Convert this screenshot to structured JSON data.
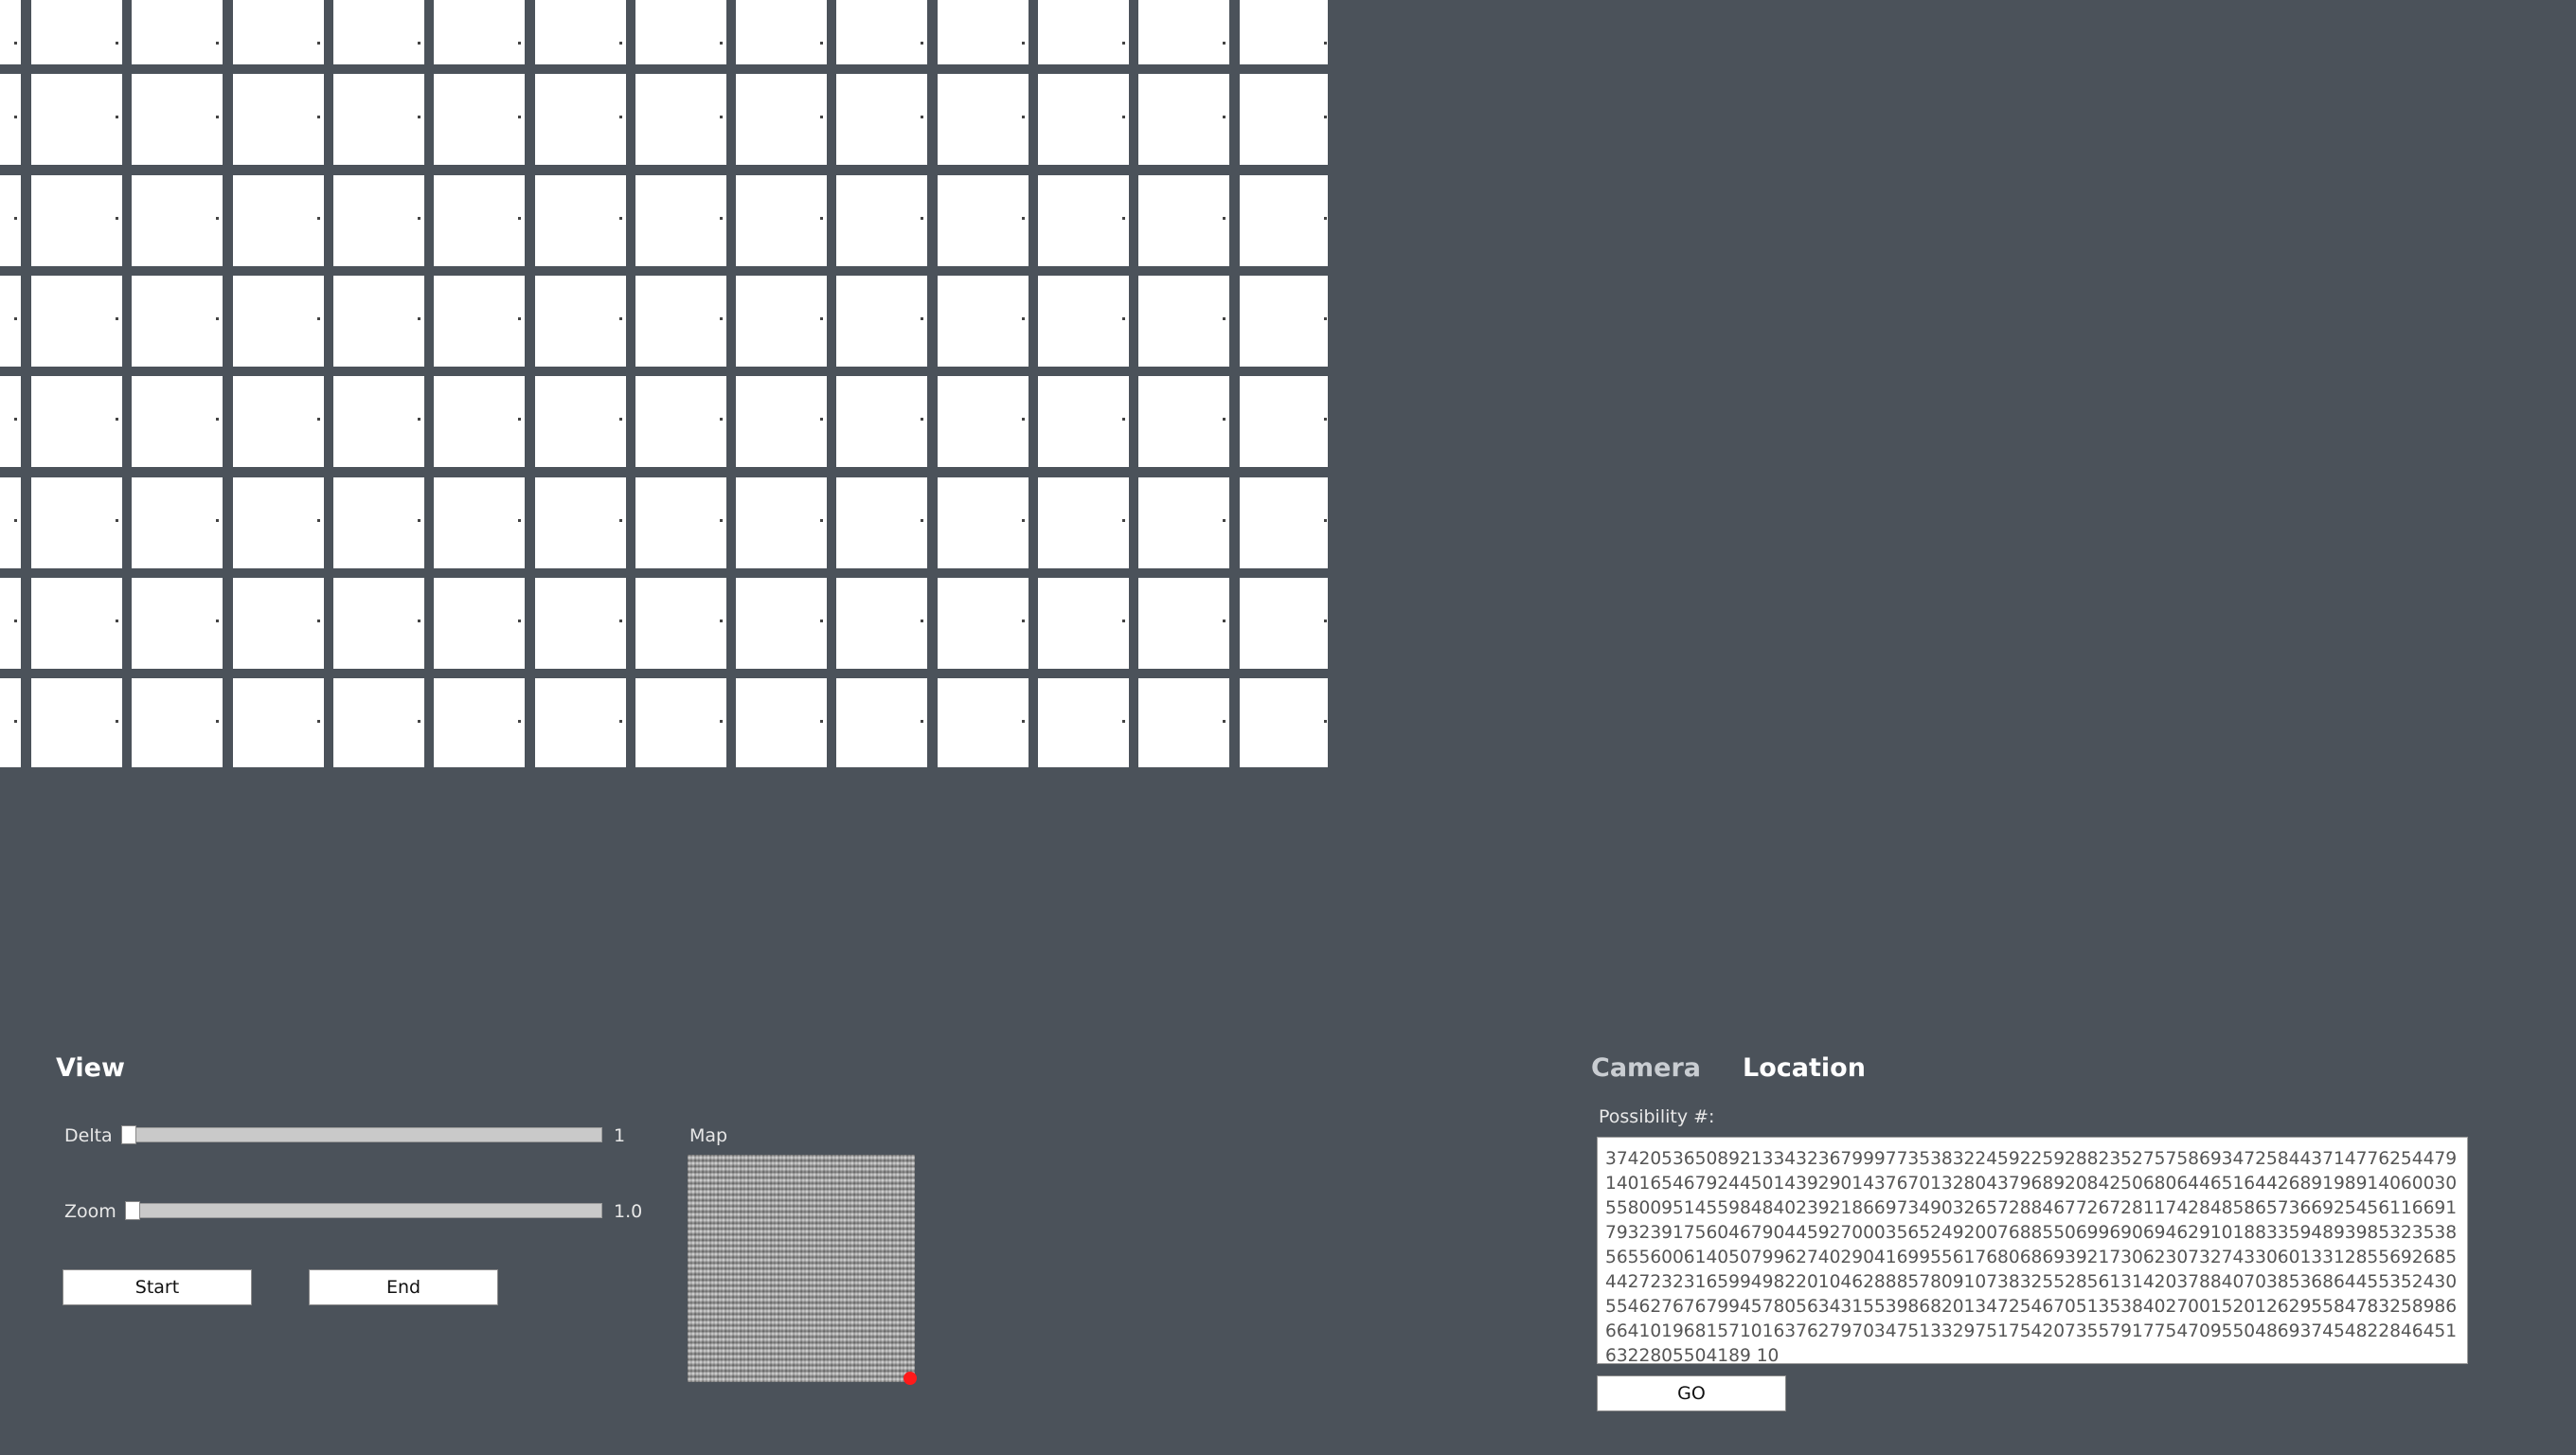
{
  "view_panel": {
    "title": "View",
    "delta": {
      "label": "Delta",
      "value": "1",
      "fraction": 0
    },
    "zoom": {
      "label": "Zoom",
      "value": "1.0",
      "fraction": 0
    },
    "start_label": "Start",
    "end_label": "End",
    "map_label": "Map"
  },
  "right_panel": {
    "tabs": [
      {
        "label": "Camera",
        "active": false
      },
      {
        "label": "Location",
        "active": true
      }
    ],
    "possibility_label": "Possibility #:",
    "possibility_value": "374205365089213343236799977353832245922592882352757586934725844371477625447914016546792445014392901437670132804379689208425068064465164426891989140600305580095145598484023921866973490326572884677267281174284858657366925456116691793239175604679044592700035652492007688550699690694629101883359489398532353856556006140507996274029041699556176806869392173062307327433060133128556926854427232316599498220104628885780910738325528561314203788407038536864455352430554627676799457805634315539868201347254670513538402700152012629558478325898666410196815710163762797034751332975175420735579177547095504869374548228464516322805504189 10",
    "go_label": "GO"
  },
  "colors": {
    "background": "#4b525a",
    "cell": "#ffffff",
    "marker": "#ff1a1a"
  }
}
